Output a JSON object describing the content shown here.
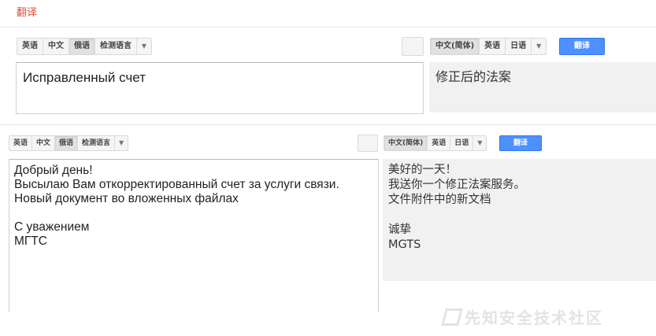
{
  "page_title": "翻译",
  "panel1": {
    "source_langs": [
      {
        "label": "英语",
        "active": false
      },
      {
        "label": "中文",
        "active": false
      },
      {
        "label": "俄语",
        "active": true
      },
      {
        "label": "检测语言",
        "active": false
      }
    ],
    "target_langs": [
      {
        "label": "中文(简体)",
        "active": true
      },
      {
        "label": "英语",
        "active": false
      },
      {
        "label": "日语",
        "active": false
      }
    ],
    "translate_label": "翻译",
    "source_text": "Исправленный счет",
    "result_text": "修正后的法案"
  },
  "panel2": {
    "source_langs": [
      {
        "label": "英语",
        "active": false
      },
      {
        "label": "中文",
        "active": false
      },
      {
        "label": "俄语",
        "active": true
      },
      {
        "label": "检测语言",
        "active": false
      }
    ],
    "target_langs": [
      {
        "label": "中文(简体)",
        "active": true
      },
      {
        "label": "英语",
        "active": false
      },
      {
        "label": "日语",
        "active": false
      }
    ],
    "translate_label": "翻译",
    "source_text": "Добрый день!\nВысылаю Вам откорректированный счет за услуги связи.\nНовый документ во вложенных файлах\n\nС уважением\nМГТС",
    "result_text": "美好的一天！\n我送你一个修正法案服务。\n文件附件中的新文档\n\n诚挚\nMGTS"
  },
  "watermark": "先知安全技术社区",
  "colors": {
    "title": "#dd4b39",
    "translate_button": "#4d90fe",
    "output_bg": "#f1f1f1"
  }
}
